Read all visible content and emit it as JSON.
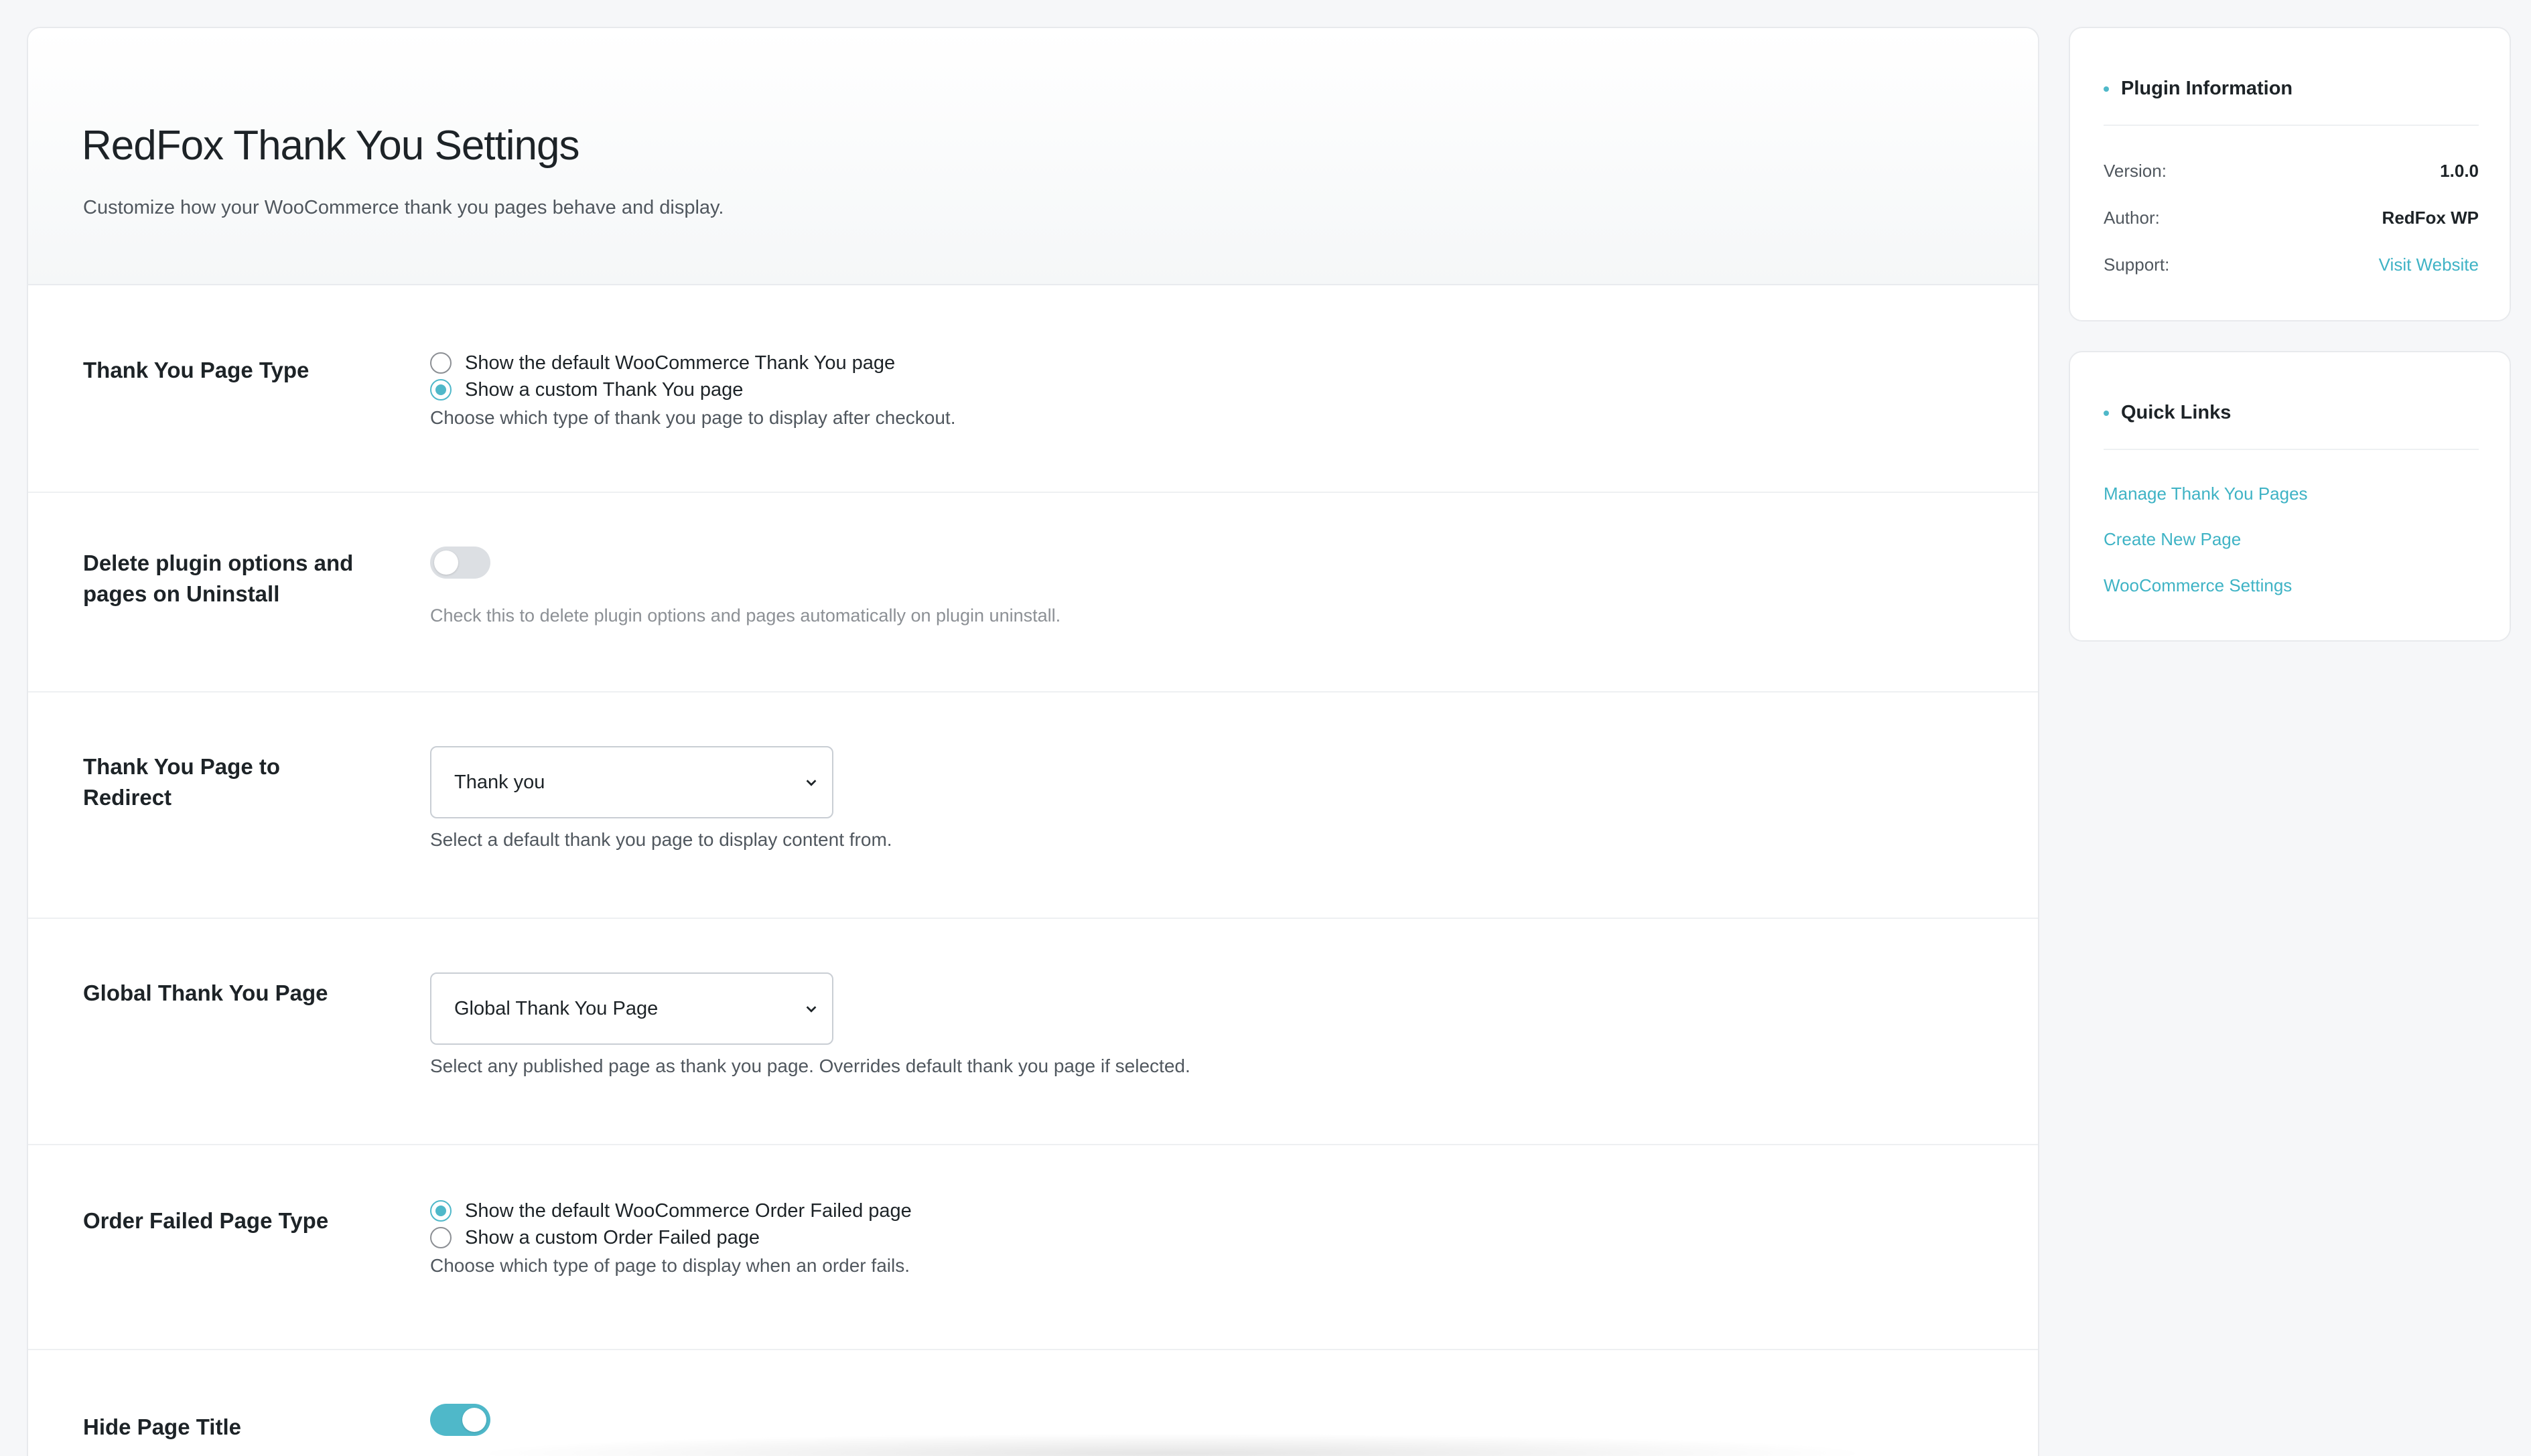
{
  "header": {
    "title": "RedFox Thank You Settings",
    "subtitle": "Customize how your WooCommerce thank you pages behave and display."
  },
  "settings": {
    "thank_you_type": {
      "label": "Thank You Page Type",
      "options": [
        "Show the default WooCommerce Thank You page",
        "Show a custom Thank You page"
      ],
      "selected_index": 1,
      "help": "Choose which type of thank you page to display after checkout."
    },
    "delete_on_uninstall": {
      "label": "Delete plugin options and pages on Uninstall",
      "enabled": false,
      "help": "Check this to delete plugin options and pages automatically on plugin uninstall."
    },
    "redirect_page": {
      "label": "Thank You Page to Redirect",
      "value": "Thank you",
      "help": "Select a default thank you page to display content from."
    },
    "global_page": {
      "label": "Global Thank You Page",
      "value": "Global Thank You Page",
      "help": "Select any published page as thank you page. Overrides default thank you page if selected."
    },
    "order_failed_type": {
      "label": "Order Failed Page Type",
      "options": [
        "Show the default WooCommerce Order Failed page",
        "Show a custom Order Failed page"
      ],
      "selected_index": 0,
      "help": "Choose which type of page to display when an order fails."
    },
    "hide_page_title": {
      "label": "Hide Page Title",
      "enabled": true
    }
  },
  "sidebar": {
    "plugin_info": {
      "title": "Plugin Information",
      "rows": [
        {
          "key": "Version:",
          "value": "1.0.0"
        },
        {
          "key": "Author:",
          "value": "RedFox WP"
        },
        {
          "key": "Support:",
          "value": "Visit Website"
        }
      ]
    },
    "quick_links": {
      "title": "Quick Links",
      "links": [
        "Manage Thank You Pages",
        "Create New Page",
        "WooCommerce Settings"
      ]
    }
  },
  "colors": {
    "accent": "#4fb8c9",
    "link": "#3fb3c5",
    "text": "#1d2327",
    "muted": "#50575e"
  },
  "icons": {
    "select_chevron": "chevron-down-icon",
    "section_bullet": "dot-icon"
  }
}
